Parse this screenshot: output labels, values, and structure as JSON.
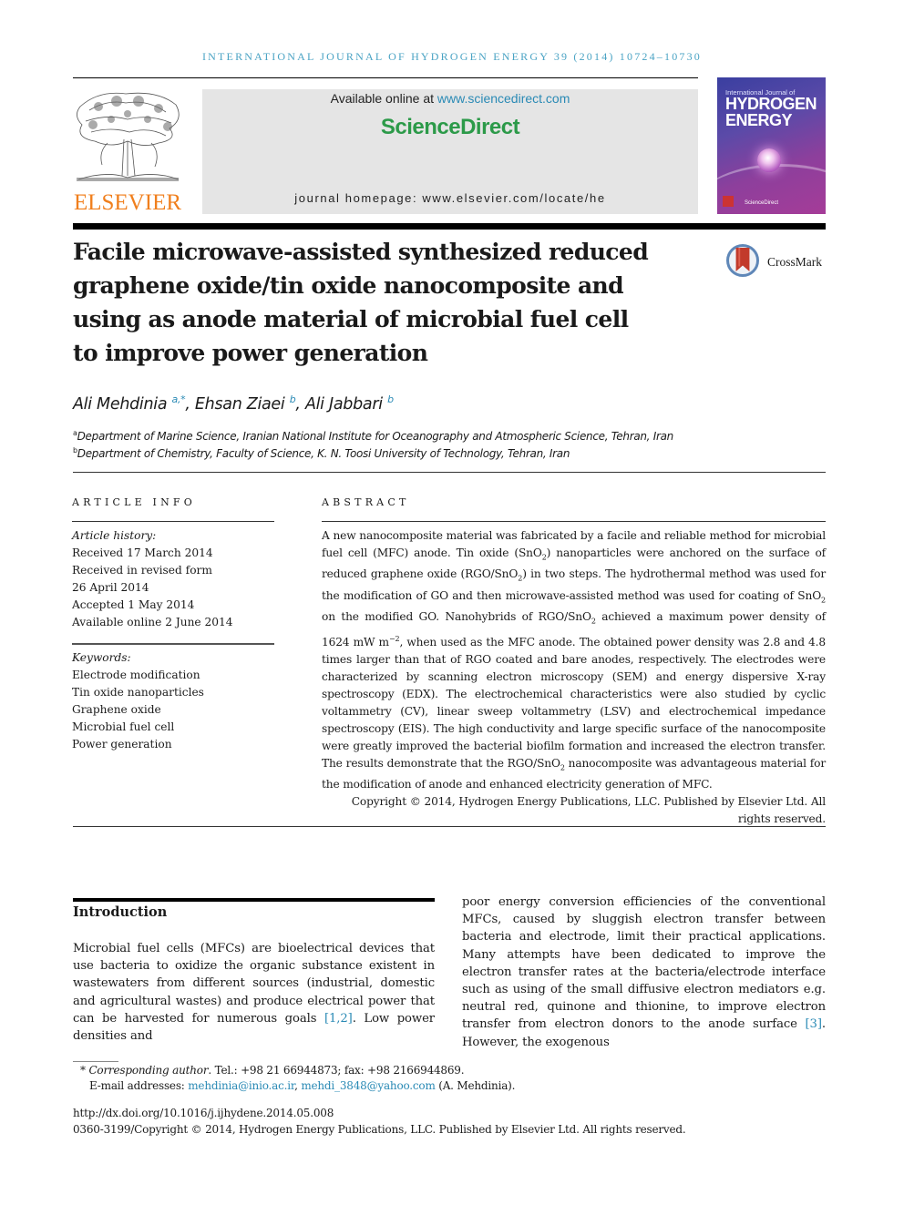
{
  "header": {
    "running_title": "INTERNATIONAL JOURNAL OF HYDROGEN ENERGY 39 (2014) 10724–10730",
    "publisher_wordmark": "ELSEVIER",
    "available_online_prefix": "Available online at ",
    "available_online_link": "www.sciencedirect.com",
    "platform_name": "ScienceDirect",
    "journal_homepage": "journal homepage: www.elsevier.com/locate/he",
    "cover": {
      "line1": "International Journal of",
      "line2": "HYDROGEN",
      "line3": "ENERGY"
    },
    "colors": {
      "elsevier_orange": "#f07f1d",
      "sciencedirect_green": "#2c9a49",
      "link_blue": "#2a8ab5"
    }
  },
  "article": {
    "title": "Facile microwave-assisted synthesized reduced graphene oxide/tin oxide nanocomposite and using as anode material of microbial fuel cell to improve power generation",
    "title_lines": [
      "Facile microwave-assisted synthesized reduced",
      "graphene oxide/tin oxide nanocomposite and",
      "using as anode material of microbial fuel cell",
      "to improve power generation"
    ],
    "crossmark_label": "CrossMark",
    "authors": [
      {
        "name": "Ali Mehdinia",
        "marks": "a,*"
      },
      {
        "name": "Ehsan Ziaei",
        "marks": "b"
      },
      {
        "name": "Ali Jabbari",
        "marks": "b"
      }
    ],
    "affiliations": [
      {
        "mark": "a",
        "text": "Department of Marine Science, Iranian National Institute for Oceanography and Atmospheric Science, Tehran, Iran"
      },
      {
        "mark": "b",
        "text": "Department of Chemistry, Faculty of Science, K. N. Toosi University of Technology, Tehran, Iran"
      }
    ]
  },
  "article_info": {
    "heading": "ARTICLE INFO",
    "history_label": "Article history:",
    "history": [
      "Received 17 March 2014",
      "Received in revised form",
      "26 April 2014",
      "Accepted 1 May 2014",
      "Available online 2 June 2014"
    ],
    "keywords_label": "Keywords:",
    "keywords": [
      "Electrode modification",
      "Tin oxide nanoparticles",
      "Graphene oxide",
      "Microbial fuel cell",
      "Power generation"
    ]
  },
  "abstract": {
    "heading": "ABSTRACT",
    "p1": "A new nanocomposite material was fabricated by a facile and reliable method for microbial fuel cell (MFC) anode. Tin oxide (SnO",
    "p2": ") nanoparticles were anchored on the surface of reduced graphene oxide (RGO/SnO",
    "p3": ") in two steps. The hydrothermal method was used for the modification of GO and then microwave-assisted method was used for coating of SnO",
    "p4": " on the modified GO. Nanohybrids of RGO/SnO",
    "p5": " achieved a maximum power density of 1624 mW m",
    "p5_sup": "−2",
    "p6": ", when used as the MFC anode. The obtained power density was 2.8 and 4.8 times larger than that of RGO coated and bare anodes, respectively. The electrodes were characterized by scanning electron microscopy (SEM) and energy dispersive X-ray spectroscopy (EDX). The electrochemical characteristics were also studied by cyclic voltammetry (CV), linear sweep voltammetry (LSV) and electrochemical impedance spectroscopy (EIS). The high conductivity and large specific surface of the nanocomposite were greatly improved the bacterial biofilm formation and increased the electron transfer. The results demonstrate that the RGO/SnO",
    "p7": " nanocomposite was advantageous material for the modification of anode and enhanced electricity generation of MFC.",
    "subscript_2": "2",
    "copyright": "Copyright © 2014, Hydrogen Energy Publications, LLC. Published by Elsevier Ltd. All rights reserved."
  },
  "introduction": {
    "heading": "Introduction",
    "left_text_before_ref": "Microbial fuel cells (MFCs) are bioelectrical devices that use bacteria to oxidize the organic substance existent in wastewaters from different sources (industrial, domestic and agricultural wastes) and produce electrical power that can be harvested for numerous goals ",
    "left_ref": "[1,2]",
    "left_text_after_ref": ". Low power densities and",
    "right_text_before_ref": "poor energy conversion efficiencies of the conventional MFCs, caused by sluggish electron transfer between bacteria and electrode, limit their practical applications. Many attempts have been dedicated to improve the electron transfer rates at the bacteria/electrode interface such as using of the small diffusive electron mediators e.g. neutral red, quinone and thionine, to improve electron transfer from electron donors to the anode surface ",
    "right_ref": "[3]",
    "right_text_after_ref": ". However, the exogenous"
  },
  "footnotes": {
    "corresponding_mark": "*",
    "corresponding_label": "Corresponding author",
    "contact": ". Tel.: +98 21 66944873; fax: +98 2166944869.",
    "email_label": "E-mail addresses: ",
    "email1": "mehdinia@inio.ac.ir",
    "email_sep": ", ",
    "email2": "mehdi_3848@yahoo.com",
    "email_owner": " (A. Mehdinia).",
    "doi": "http://dx.doi.org/10.1016/j.ijhydene.2014.05.008",
    "issn_copyright": "0360-3199/Copyright © 2014, Hydrogen Energy Publications, LLC. Published by Elsevier Ltd. All rights reserved."
  }
}
